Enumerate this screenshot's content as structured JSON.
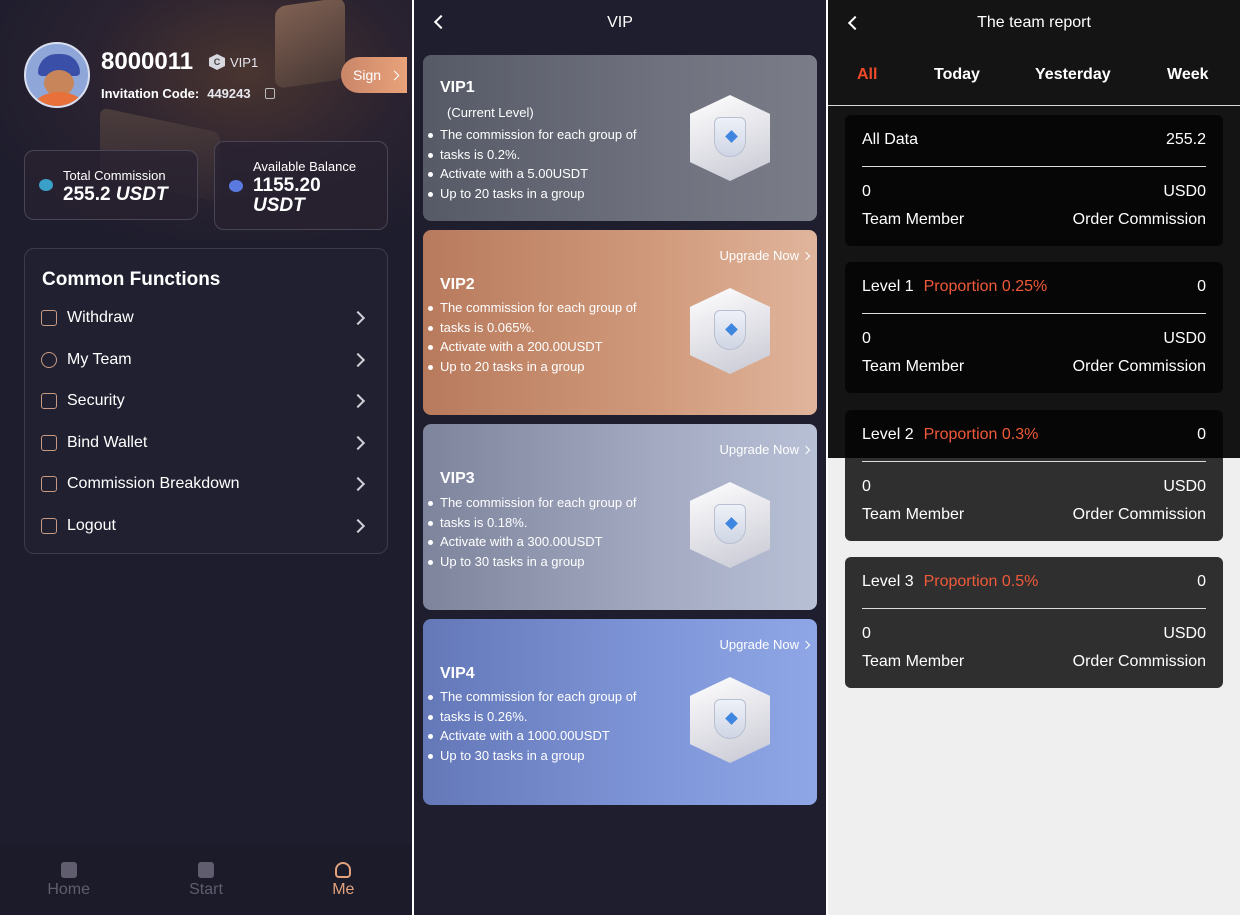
{
  "me": {
    "user_id": "8000011",
    "vip_level": "VIP1",
    "vip_hex": "C",
    "invitation_label": "Invitation Code:",
    "invitation_code": "449243",
    "sign_label": "Sign",
    "total_commission_label": "Total Commission",
    "total_commission_value": "255.2",
    "total_commission_unit": "USDT",
    "available_balance_label": "Available Balance",
    "available_balance_value": "1155.20",
    "available_balance_unit": "USDT",
    "functions_title": "Common Functions",
    "functions": [
      {
        "label": "Withdraw",
        "icon": "wallet-icon"
      },
      {
        "label": "My Team",
        "icon": "team-icon"
      },
      {
        "label": "Security",
        "icon": "security-icon"
      },
      {
        "label": "Bind Wallet",
        "icon": "bind-wallet-icon"
      },
      {
        "label": "Commission Breakdown",
        "icon": "document-icon"
      },
      {
        "label": "Logout",
        "icon": "logout-icon"
      }
    ],
    "tabs": [
      {
        "label": "Home",
        "icon": "home-icon"
      },
      {
        "label": "Start",
        "icon": "clipboard-icon"
      },
      {
        "label": "Me",
        "icon": "user-icon"
      }
    ],
    "active_tab": "Me",
    "accent": "#e2a27d"
  },
  "vip": {
    "title": "VIP",
    "upgrade_label": "Upgrade Now",
    "current_level_label": "(Current Level)",
    "cards": [
      {
        "name": "VIP1",
        "lines": [
          "The commission for each group of",
          "tasks is 0.2%.",
          "Activate with a 5.00USDT",
          "Up to 20 tasks in a group"
        ],
        "color": "#6b6e7a"
      },
      {
        "name": "VIP2",
        "lines": [
          "The commission for each group of",
          "tasks is 0.065%.",
          "Activate with a 200.00USDT",
          "Up to 20 tasks in a group"
        ],
        "color": "#c98f6c"
      },
      {
        "name": "VIP3",
        "lines": [
          "The commission for each group of",
          "tasks is 0.18%.",
          "Activate with a 300.00USDT",
          "Up to 30 tasks in a group"
        ],
        "color": "#9aa2bf"
      },
      {
        "name": "VIP4",
        "lines": [
          "The commission for each group of",
          "tasks is 0.26%.",
          "Activate with a 1000.00USDT",
          "Up to 30 tasks in a group"
        ],
        "color": "#7e93d4"
      }
    ]
  },
  "team": {
    "title": "The team report",
    "tabs": [
      "All",
      "Today",
      "Yesterday",
      "Week"
    ],
    "active_tab": "All",
    "accent": "#f04a2a",
    "team_member_label": "Team Member",
    "order_commission_label": "Order Commission",
    "cards": [
      {
        "title": "All Data",
        "proportion": "",
        "right_value": "255.2",
        "members": "0",
        "commission": "USD0"
      },
      {
        "title": "Level 1",
        "proportion": "Proportion 0.25%",
        "right_value": "0",
        "members": "0",
        "commission": "USD0"
      },
      {
        "title": "Level 2",
        "proportion": "Proportion 0.3%",
        "right_value": "0",
        "members": "0",
        "commission": "USD0"
      },
      {
        "title": "Level 3",
        "proportion": "Proportion 0.5%",
        "right_value": "0",
        "members": "0",
        "commission": "USD0"
      }
    ]
  }
}
